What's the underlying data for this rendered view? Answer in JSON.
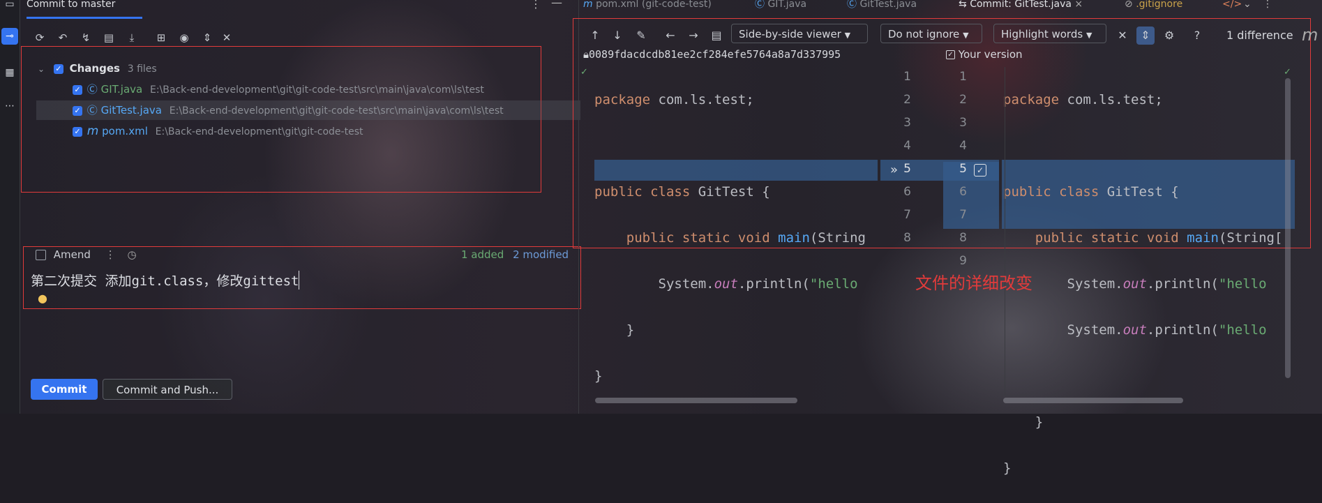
{
  "left_panel": {
    "tab_title": "Commit to master",
    "changes_label": "Changes",
    "changes_count": "3 files",
    "files": [
      {
        "name": "GIT.java",
        "path": "E:\\Back-end-development\\git\\git-code-test\\src\\main\\java\\com\\ls\\test",
        "color": "#6aab73"
      },
      {
        "name": "GitTest.java",
        "path": "E:\\Back-end-development\\git\\git-code-test\\src\\main\\java\\com\\ls\\test",
        "color": "#56a8f5"
      },
      {
        "name": "pom.xml",
        "path": "E:\\Back-end-development\\git\\git-code-test",
        "color": "#56a8f5"
      }
    ],
    "amend_label": "Amend",
    "added_label": "1 added",
    "modified_label": "2 modified",
    "commit_message": "第二次提交 添加git.class，修改gittest",
    "commit_button": "Commit",
    "commit_push_button": "Commit and Push..."
  },
  "editor_tabs": [
    {
      "label": "pom.xml (git-code-test)"
    },
    {
      "label": "GIT.java"
    },
    {
      "label": "GitTest.java"
    },
    {
      "label": "Commit: GitTest.java"
    },
    {
      "label": ".gitignore"
    }
  ],
  "diff_toolbar": {
    "viewer": "Side-by-side viewer",
    "ignore": "Do not ignore",
    "highlight": "Highlight words",
    "differences": "1 difference"
  },
  "diff": {
    "left_header": "0089fdacdcdb81ee2cf284efe5764a8a7d337995",
    "right_header": "Your version",
    "left_lines": [
      "package com.ls.test;",
      "",
      "public class GitTest {",
      "    public static void main(String",
      "        System.out.println(\"hello",
      "    }",
      "}"
    ],
    "right_lines": [
      "package com.ls.test;",
      "",
      "public class GitTest {",
      "    public static void main(String[",
      "        System.out.println(\"hello",
      "        System.out.println(\"hello",
      "",
      "    }",
      "}"
    ],
    "left_numbers": [
      "1",
      "2",
      "3",
      "4",
      "5",
      "6",
      "7",
      "8"
    ],
    "right_numbers": [
      "1",
      "2",
      "3",
      "4",
      "5",
      "6",
      "7",
      "8",
      "9"
    ]
  },
  "annotation": "文件的详细改变",
  "colors": {
    "accent": "#3574f0",
    "annotation_red": "#e23b3b",
    "added": "#6aab73",
    "modified": "#6d9bd8"
  }
}
